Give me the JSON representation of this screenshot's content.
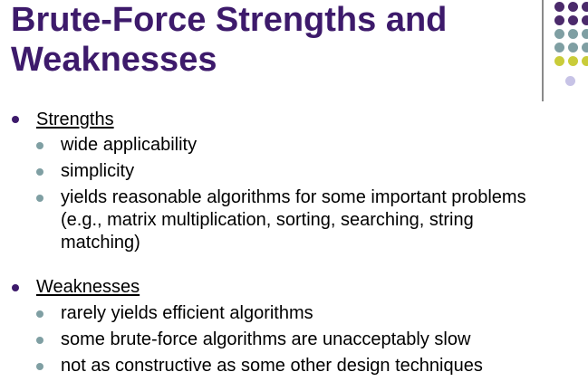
{
  "slide": {
    "title": "Brute-Force Strengths and Weaknesses",
    "sections": [
      {
        "heading": "Strengths",
        "items": [
          {
            "lines": [
              "wide applicability"
            ]
          },
          {
            "lines": [
              "simplicity"
            ]
          },
          {
            "lines": [
              "yields reasonable algorithms for some important problems",
              "(e.g., matrix multiplication, sorting, searching, string",
              "matching)"
            ]
          }
        ]
      },
      {
        "heading": "Weaknesses",
        "items": [
          {
            "lines": [
              "rarely yields efficient algorithms"
            ]
          },
          {
            "lines": [
              "some brute-force algorithms are unacceptably slow"
            ]
          },
          {
            "lines": [
              "not as constructive as some other design techniques"
            ]
          }
        ]
      }
    ]
  },
  "theme": {
    "title_color": "#3d1a6b",
    "bullet_primary": "#3d1a6b",
    "bullet_secondary": "#7f9fa3",
    "decor_dot_colors": [
      "#4b2a6b",
      "#7f9fa3",
      "#c9cc3a",
      "#c7c3e6"
    ]
  }
}
